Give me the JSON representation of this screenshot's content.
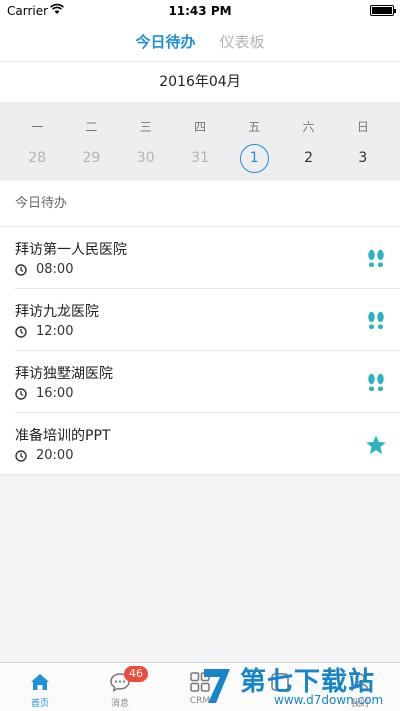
{
  "status_bar": {
    "carrier": "Carrier",
    "time": "11:43 PM",
    "battery_level": 1.0
  },
  "top_tabs": [
    {
      "label": "今日待办",
      "active": true
    },
    {
      "label": "仪表板",
      "active": false
    }
  ],
  "calendar": {
    "month_label": "2016年04月",
    "weekdays": [
      "一",
      "二",
      "三",
      "四",
      "五",
      "六",
      "日"
    ],
    "dates": [
      {
        "day": "28",
        "state": "dim"
      },
      {
        "day": "29",
        "state": "dim"
      },
      {
        "day": "30",
        "state": "dim"
      },
      {
        "day": "31",
        "state": "dim"
      },
      {
        "day": "1",
        "state": "today"
      },
      {
        "day": "2",
        "state": "normal"
      },
      {
        "day": "3",
        "state": "normal"
      }
    ]
  },
  "todo": {
    "section_title": "今日待办",
    "items": [
      {
        "title": "拜访第一人民医院",
        "time": "08:00",
        "icon": "footprints-icon"
      },
      {
        "title": "拜访九龙医院",
        "time": "12:00",
        "icon": "footprints-icon"
      },
      {
        "title": "拜访独墅湖医院",
        "time": "16:00",
        "icon": "footprints-icon"
      },
      {
        "title": "准备培训的PPT",
        "time": "20:00",
        "icon": "star-icon"
      }
    ]
  },
  "tabbar": {
    "tabs": [
      {
        "label": "首页",
        "icon": "home-icon",
        "active": true
      },
      {
        "label": "消息",
        "icon": "chat-icon",
        "badge": "46"
      },
      {
        "label": "CRM",
        "icon": "grid-icon"
      },
      {
        "label": "",
        "icon": "apps-icon"
      },
      {
        "label": "我的",
        "icon": "person-icon"
      }
    ]
  },
  "watermark": {
    "text": "第七下载站",
    "url": "www.d7down.com"
  },
  "colors": {
    "accent": "#1e90d8",
    "teal": "#2bb3c0",
    "badge": "#f04a3a"
  }
}
